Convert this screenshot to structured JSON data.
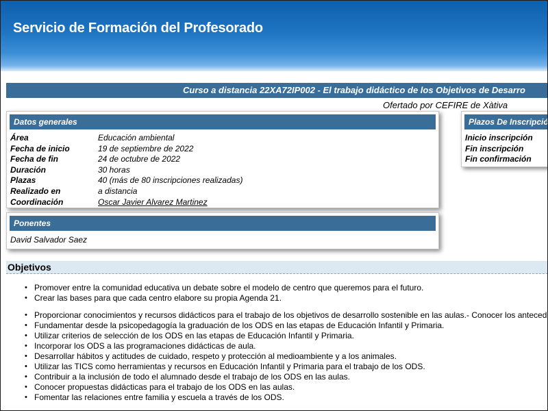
{
  "header": {
    "title": "Servicio de Formación del Profesorado"
  },
  "course": {
    "title": "Curso a distancia 22XA72IP002 - El trabajo didáctico de los Objetivos de Desarro",
    "offered_by": "Ofertado por CEFIRE de Xàtiva"
  },
  "datos_generales": {
    "heading": "Datos generales",
    "rows": [
      {
        "label": "Área",
        "value": "Educación ambiental"
      },
      {
        "label": "Fecha de inicio",
        "value": "19 de septiembre de 2022"
      },
      {
        "label": "Fecha de fin",
        "value": "24 de octubre de 2022"
      },
      {
        "label": "Duración",
        "value": "30 horas"
      },
      {
        "label": "Plazas",
        "value": "40 (más de 80 inscripciones realizadas)"
      },
      {
        "label": "Realizado en",
        "value": "a distancia"
      },
      {
        "label": "Coordinación",
        "value": "Oscar Javier Alvarez Martinez"
      }
    ]
  },
  "ponentes": {
    "heading": "Ponentes",
    "names": [
      "David Salvador Saez"
    ]
  },
  "plazos": {
    "heading": "Plazos De Inscripció",
    "rows": [
      {
        "label": "Inicio inscripción"
      },
      {
        "label": "Fin inscripción"
      },
      {
        "label": "Fin confirmación"
      }
    ]
  },
  "objetivos": {
    "heading": "Objetivos",
    "group1": [
      "Promover entre la comunidad educativa un debate sobre el modelo de centro que queremos para el futuro.",
      "Crear las bases para que cada centro elabore su propia Agenda 21."
    ],
    "group2": [
      "Proporcionar conocimientos y recursos didácticos para el trabajo de los objetivos de desarrollo sostenible en las aulas.- Conocer los anteced",
      "Fundamentar desde la psicopedagogía la graduación de los ODS en las etapas de Educación Infantil y Primaria.",
      "Utilizar criterios de selección de los ODS en las etapas de Educación Infantil y Primaria.",
      "Incorporar los ODS a las programaciones didácticas de aula.",
      "Desarrollar hábitos y actitudes de cuidado, respeto y protección al medioambiente y a los animales.",
      "Utilizar las TICS como herramientas y recursos en Educación Infantil y Primaria para el trabajo de los ODS.",
      "Contribuir a la inclusión de todo el alumnado desde el trabajo de los ODS en las aulas.",
      "Conocer propuestas didácticas para el trabajo de los ODS en las aulas.",
      "Fomentar las relaciones entre familia y escuela a través de los ODS."
    ]
  }
}
